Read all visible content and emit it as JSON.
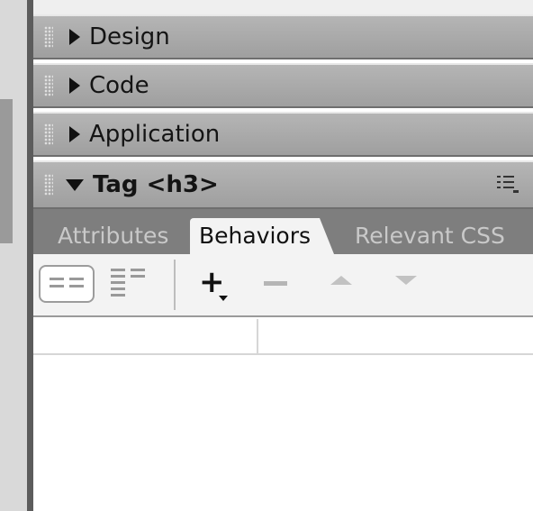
{
  "panels": [
    {
      "label": "Design",
      "expanded": false
    },
    {
      "label": "Code",
      "expanded": false
    },
    {
      "label": "Application",
      "expanded": false
    },
    {
      "label": "Tag <h3>",
      "expanded": true
    }
  ],
  "tag_panel": {
    "tabs": [
      {
        "label": "Attributes",
        "active": false
      },
      {
        "label": "Behaviors",
        "active": true
      },
      {
        "label": "Relevant CSS",
        "active": false
      }
    ],
    "toolbar": {
      "show_set_events": "show-set-events-icon",
      "show_all_events": "show-all-events-icon",
      "add_behavior": "+",
      "remove_behavior": "minus-icon",
      "move_up": "up-arrow-icon",
      "move_down": "down-arrow-icon"
    },
    "list": {
      "columns": [
        "",
        ""
      ],
      "rows": []
    }
  },
  "colors": {
    "panel_header": "#a9a9a9",
    "tab_bar": "#7e7e7e",
    "active_tab": "#f3f3f3",
    "chrome_left": "#5c5c5c"
  }
}
